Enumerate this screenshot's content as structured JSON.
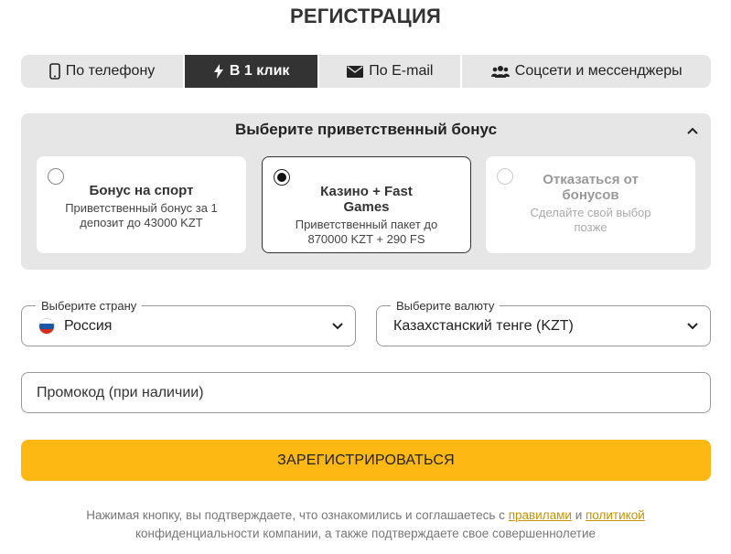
{
  "page": {
    "title": "РЕГИСТРАЦИЯ"
  },
  "tabs": [
    {
      "label": "По телефону",
      "icon": "phone-icon"
    },
    {
      "label": "В 1 клик",
      "icon": "lightning-icon",
      "active": true
    },
    {
      "label": "По E-mail",
      "icon": "envelope-icon"
    },
    {
      "label": "Соцсети и мессенджеры",
      "icon": "users-icon"
    }
  ],
  "bonus": {
    "title": "Выберите приветственный бонус",
    "options": [
      {
        "title": "Бонус на спорт",
        "desc": "Приветственный бонус за 1 депозит до 43000 KZT",
        "selected": false
      },
      {
        "title": "Казино + Fast Games",
        "desc": "Приветственный пакет до 870000 KZT + 290 FS",
        "selected": true
      },
      {
        "title": "Отказаться от бонусов",
        "desc": "Сделайте свой выбор позже",
        "selected": false
      }
    ]
  },
  "country": {
    "label": "Выберите страну",
    "value": "Россия"
  },
  "currency": {
    "label": "Выберите валюту",
    "value": "Казахстанский тенге (KZT)"
  },
  "promo": {
    "placeholder": "Промокод (при наличии)"
  },
  "register": {
    "label": "ЗАРЕГИСТРИРОВАТЬСЯ"
  },
  "terms": {
    "before": "Нажимая кнопку, вы подтверждаете, что ознакомились и соглашаетесь с ",
    "rules_link": "правилами",
    "and": " и ",
    "policy_link": "политикой",
    "after": "конфиденциальности компании, а также подтверждаете свое совершеннолетие"
  },
  "colors": {
    "accent": "#fdb813",
    "active_tab": "#333333",
    "panel": "#e6e6e6",
    "link": "#c69300"
  }
}
